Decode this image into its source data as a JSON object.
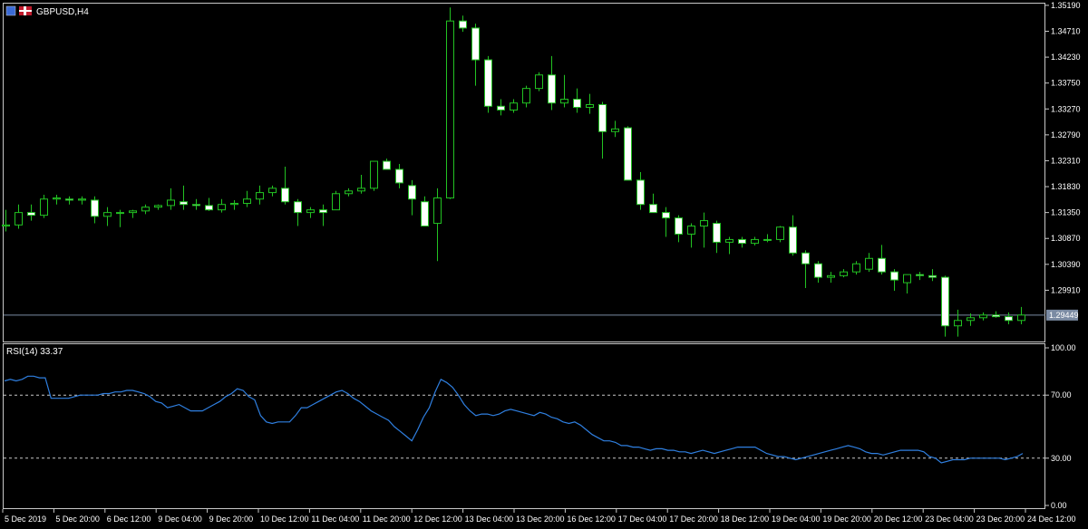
{
  "window": {
    "symbol_title": "GBPUSD,H4",
    "indicator_title": "RSI(14) 33.37"
  },
  "colors": {
    "background": "#000000",
    "frame": "#c8c8c8",
    "bull_body": "#000000",
    "bull_outline": "#22c222",
    "bear_body": "#ffffff",
    "wick": "#22c222",
    "rsi_line": "#2f7fe0",
    "price_line": "#7b8ba3",
    "price_badge": "#7b8ba3"
  },
  "chart_data": [
    {
      "type": "candlestick",
      "title": "GBPUSD,H4",
      "ylim": [
        1.2896,
        1.35222
      ],
      "y_ticks": [
        "1.35190",
        "1.34710",
        "1.34230",
        "1.33750",
        "1.33270",
        "1.32790",
        "1.32310",
        "1.31830",
        "1.31350",
        "1.30870",
        "1.30390",
        "1.29910",
        "1.29449"
      ],
      "current_price": "1.29449",
      "x_labels": [
        "5 Dec 2019",
        "5 Dec 20:00",
        "6 Dec 12:00",
        "9 Dec 04:00",
        "9 Dec 20:00",
        "10 Dec 12:00",
        "11 Dec 04:00",
        "11 Dec 20:00",
        "12 Dec 12:00",
        "13 Dec 04:00",
        "13 Dec 20:00",
        "16 Dec 12:00",
        "17 Dec 04:00",
        "17 Dec 20:00",
        "18 Dec 12:00",
        "19 Dec 04:00",
        "19 Dec 20:00",
        "20 Dec 12:00",
        "23 Dec 04:00",
        "23 Dec 20:00",
        "24 Dec 12:00"
      ],
      "candles": [
        {
          "o": 1.311,
          "h": 1.314,
          "l": 1.31,
          "c": 1.3112
        },
        {
          "o": 1.3112,
          "h": 1.315,
          "l": 1.3105,
          "c": 1.3135
        },
        {
          "o": 1.3135,
          "h": 1.315,
          "l": 1.312,
          "c": 1.313
        },
        {
          "o": 1.313,
          "h": 1.3168,
          "l": 1.3125,
          "c": 1.316
        },
        {
          "o": 1.316,
          "h": 1.3168,
          "l": 1.315,
          "c": 1.3162
        },
        {
          "o": 1.316,
          "h": 1.3165,
          "l": 1.315,
          "c": 1.3158
        },
        {
          "o": 1.3158,
          "h": 1.3165,
          "l": 1.315,
          "c": 1.316
        },
        {
          "o": 1.3158,
          "h": 1.3165,
          "l": 1.3115,
          "c": 1.3128
        },
        {
          "o": 1.3128,
          "h": 1.3145,
          "l": 1.311,
          "c": 1.3135
        },
        {
          "o": 1.3135,
          "h": 1.314,
          "l": 1.3108,
          "c": 1.3135
        },
        {
          "o": 1.3135,
          "h": 1.314,
          "l": 1.3125,
          "c": 1.3138
        },
        {
          "o": 1.3138,
          "h": 1.315,
          "l": 1.3132,
          "c": 1.3145
        },
        {
          "o": 1.3145,
          "h": 1.315,
          "l": 1.314,
          "c": 1.3148
        },
        {
          "o": 1.3148,
          "h": 1.318,
          "l": 1.314,
          "c": 1.3158
        },
        {
          "o": 1.3155,
          "h": 1.3185,
          "l": 1.314,
          "c": 1.315
        },
        {
          "o": 1.315,
          "h": 1.316,
          "l": 1.314,
          "c": 1.3148
        },
        {
          "o": 1.3148,
          "h": 1.3162,
          "l": 1.3138,
          "c": 1.314
        },
        {
          "o": 1.314,
          "h": 1.316,
          "l": 1.3135,
          "c": 1.315
        },
        {
          "o": 1.315,
          "h": 1.3158,
          "l": 1.314,
          "c": 1.3152
        },
        {
          "o": 1.3152,
          "h": 1.3175,
          "l": 1.3145,
          "c": 1.316
        },
        {
          "o": 1.316,
          "h": 1.3185,
          "l": 1.315,
          "c": 1.3172
        },
        {
          "o": 1.3172,
          "h": 1.3185,
          "l": 1.3165,
          "c": 1.318
        },
        {
          "o": 1.318,
          "h": 1.322,
          "l": 1.315,
          "c": 1.3155
        },
        {
          "o": 1.3155,
          "h": 1.316,
          "l": 1.311,
          "c": 1.3135
        },
        {
          "o": 1.3135,
          "h": 1.3145,
          "l": 1.3125,
          "c": 1.314
        },
        {
          "o": 1.314,
          "h": 1.315,
          "l": 1.311,
          "c": 1.3135
        },
        {
          "o": 1.314,
          "h": 1.3175,
          "l": 1.314,
          "c": 1.317
        },
        {
          "o": 1.317,
          "h": 1.318,
          "l": 1.3165,
          "c": 1.3175
        },
        {
          "o": 1.3175,
          "h": 1.3205,
          "l": 1.317,
          "c": 1.318
        },
        {
          "o": 1.318,
          "h": 1.3225,
          "l": 1.3175,
          "c": 1.323
        },
        {
          "o": 1.323,
          "h": 1.3235,
          "l": 1.3215,
          "c": 1.3215
        },
        {
          "o": 1.3215,
          "h": 1.3225,
          "l": 1.318,
          "c": 1.319
        },
        {
          "o": 1.3185,
          "h": 1.3195,
          "l": 1.313,
          "c": 1.316
        },
        {
          "o": 1.3155,
          "h": 1.3165,
          "l": 1.311,
          "c": 1.311
        },
        {
          "o": 1.3115,
          "h": 1.318,
          "l": 1.3045,
          "c": 1.3162
        },
        {
          "o": 1.3162,
          "h": 1.3515,
          "l": 1.316,
          "c": 1.349
        },
        {
          "o": 1.349,
          "h": 1.35,
          "l": 1.347,
          "c": 1.3477
        },
        {
          "o": 1.3477,
          "h": 1.3485,
          "l": 1.337,
          "c": 1.3418
        },
        {
          "o": 1.3418,
          "h": 1.3425,
          "l": 1.332,
          "c": 1.3332
        },
        {
          "o": 1.3332,
          "h": 1.3345,
          "l": 1.3315,
          "c": 1.3325
        },
        {
          "o": 1.3325,
          "h": 1.3345,
          "l": 1.332,
          "c": 1.3338
        },
        {
          "o": 1.3338,
          "h": 1.337,
          "l": 1.333,
          "c": 1.3365
        },
        {
          "o": 1.3365,
          "h": 1.3395,
          "l": 1.336,
          "c": 1.339
        },
        {
          "o": 1.339,
          "h": 1.3425,
          "l": 1.3325,
          "c": 1.3338
        },
        {
          "o": 1.3338,
          "h": 1.339,
          "l": 1.333,
          "c": 1.3345
        },
        {
          "o": 1.3345,
          "h": 1.3365,
          "l": 1.332,
          "c": 1.333
        },
        {
          "o": 1.333,
          "h": 1.3355,
          "l": 1.3318,
          "c": 1.3335
        },
        {
          "o": 1.3335,
          "h": 1.334,
          "l": 1.3235,
          "c": 1.3285
        },
        {
          "o": 1.3285,
          "h": 1.3305,
          "l": 1.3275,
          "c": 1.329
        },
        {
          "o": 1.3292,
          "h": 1.3295,
          "l": 1.3195,
          "c": 1.3195
        },
        {
          "o": 1.3195,
          "h": 1.321,
          "l": 1.314,
          "c": 1.315
        },
        {
          "o": 1.315,
          "h": 1.317,
          "l": 1.3135,
          "c": 1.3135
        },
        {
          "o": 1.3135,
          "h": 1.3145,
          "l": 1.309,
          "c": 1.3125
        },
        {
          "o": 1.3125,
          "h": 1.313,
          "l": 1.308,
          "c": 1.3095
        },
        {
          "o": 1.3095,
          "h": 1.3115,
          "l": 1.307,
          "c": 1.311
        },
        {
          "o": 1.311,
          "h": 1.3135,
          "l": 1.307,
          "c": 1.312
        },
        {
          "o": 1.3115,
          "h": 1.312,
          "l": 1.306,
          "c": 1.308
        },
        {
          "o": 1.308,
          "h": 1.309,
          "l": 1.3058,
          "c": 1.3085
        },
        {
          "o": 1.3085,
          "h": 1.309,
          "l": 1.307,
          "c": 1.3078
        },
        {
          "o": 1.3078,
          "h": 1.309,
          "l": 1.3074,
          "c": 1.3085
        },
        {
          "o": 1.3085,
          "h": 1.3095,
          "l": 1.308,
          "c": 1.3085
        },
        {
          "o": 1.3085,
          "h": 1.311,
          "l": 1.308,
          "c": 1.3108
        },
        {
          "o": 1.3108,
          "h": 1.313,
          "l": 1.3055,
          "c": 1.306
        },
        {
          "o": 1.306,
          "h": 1.3065,
          "l": 1.2995,
          "c": 1.304
        },
        {
          "o": 1.304,
          "h": 1.3045,
          "l": 1.3005,
          "c": 1.3015
        },
        {
          "o": 1.3015,
          "h": 1.3025,
          "l": 1.3005,
          "c": 1.3018
        },
        {
          "o": 1.3018,
          "h": 1.303,
          "l": 1.3015,
          "c": 1.3025
        },
        {
          "o": 1.3025,
          "h": 1.3045,
          "l": 1.302,
          "c": 1.304
        },
        {
          "o": 1.303,
          "h": 1.306,
          "l": 1.3025,
          "c": 1.305
        },
        {
          "o": 1.305,
          "h": 1.3075,
          "l": 1.302,
          "c": 1.3025
        },
        {
          "o": 1.3025,
          "h": 1.303,
          "l": 1.299,
          "c": 1.301
        },
        {
          "o": 1.3005,
          "h": 1.302,
          "l": 1.2985,
          "c": 1.302
        },
        {
          "o": 1.302,
          "h": 1.3025,
          "l": 1.301,
          "c": 1.3018
        },
        {
          "o": 1.3018,
          "h": 1.303,
          "l": 1.3008,
          "c": 1.3015
        },
        {
          "o": 1.3015,
          "h": 1.3018,
          "l": 1.2905,
          "c": 1.2925
        },
        {
          "o": 1.2925,
          "h": 1.2955,
          "l": 1.2905,
          "c": 1.2935
        },
        {
          "o": 1.2935,
          "h": 1.2948,
          "l": 1.2925,
          "c": 1.294
        },
        {
          "o": 1.294,
          "h": 1.295,
          "l": 1.2935,
          "c": 1.2945
        },
        {
          "o": 1.2945,
          "h": 1.2952,
          "l": 1.294,
          "c": 1.2942
        },
        {
          "o": 1.2942,
          "h": 1.295,
          "l": 1.2928,
          "c": 1.2935
        },
        {
          "o": 1.2935,
          "h": 1.296,
          "l": 1.2928,
          "c": 1.2945
        }
      ]
    },
    {
      "type": "line",
      "title": "RSI(14) 33.37",
      "ylim": [
        0,
        100
      ],
      "y_ticks": [
        "100.00",
        "70.00",
        "30.00",
        "0.00"
      ],
      "levels": [
        70,
        30
      ],
      "series": [
        {
          "values": [
            79,
            80,
            79,
            80,
            82,
            82,
            81,
            81,
            68,
            68,
            68,
            68,
            69,
            70,
            70,
            70,
            70,
            71,
            71,
            72,
            72,
            73,
            73,
            72,
            71,
            69,
            66,
            65,
            62,
            63,
            64,
            62,
            60,
            60,
            60,
            62,
            64,
            66,
            69,
            71,
            74,
            73,
            69,
            67,
            57,
            53,
            52,
            53,
            53,
            53,
            57,
            62,
            62,
            64,
            66,
            68,
            70,
            72,
            73,
            71,
            68,
            66,
            63,
            60,
            58,
            56,
            54,
            50,
            47,
            44,
            41,
            48,
            56,
            62,
            72,
            80,
            78,
            75,
            70,
            64,
            60,
            57,
            58,
            58,
            57,
            58,
            60,
            61,
            60,
            59,
            58,
            57,
            59,
            58,
            56,
            55,
            53,
            52,
            53,
            51,
            48,
            45,
            43,
            41,
            41,
            40,
            38,
            38,
            37,
            37,
            36,
            35,
            36,
            36,
            35,
            35,
            34,
            34,
            33,
            34,
            35,
            34,
            33,
            34,
            35,
            36,
            37,
            37,
            37,
            37,
            35,
            33,
            32,
            31,
            31,
            30,
            29,
            30,
            31,
            32,
            33,
            34,
            35,
            36,
            37,
            38,
            37,
            36,
            34,
            33,
            33,
            32,
            33,
            34,
            35,
            35,
            35,
            35,
            34,
            31,
            30,
            27,
            28,
            29,
            29,
            29,
            30,
            30,
            30,
            30,
            30,
            30,
            29,
            30,
            31,
            33
          ]
        }
      ]
    }
  ]
}
